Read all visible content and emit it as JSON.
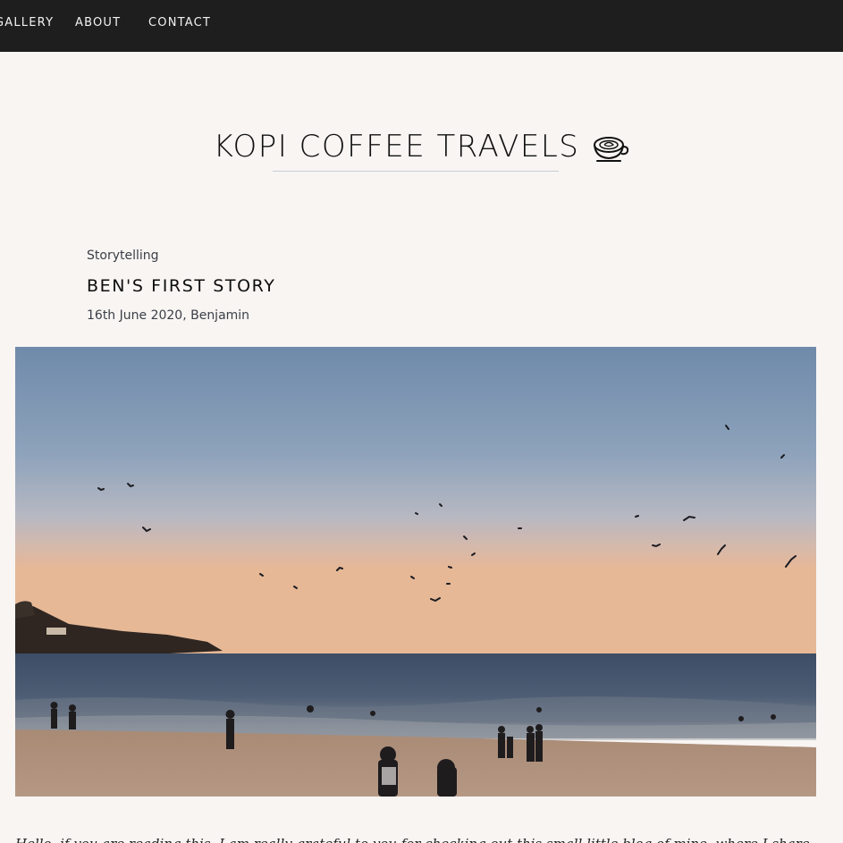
{
  "nav": {
    "items": [
      {
        "label": "GALLERY"
      },
      {
        "label": "ABOUT"
      },
      {
        "label": "CONTACT"
      }
    ],
    "background": "#1e1e1e",
    "text_color": "#f2f2f2"
  },
  "site": {
    "title": "KOPI COFFEE TRAVELS",
    "title_icon": "coffee-cup-icon"
  },
  "post": {
    "category": "Storytelling",
    "title": "BEN'S FIRST STORY",
    "meta": "16th June 2020, Benjamin",
    "hero_image": "beach-sunset-photo",
    "excerpt": "Hello, if you are reading this, I am really grateful to you for checking out this small little blog of mine, where I share"
  },
  "colors": {
    "page_background": "#f8f5f3",
    "muted_text": "#3a3f47",
    "underline": "#c8cdd6"
  }
}
